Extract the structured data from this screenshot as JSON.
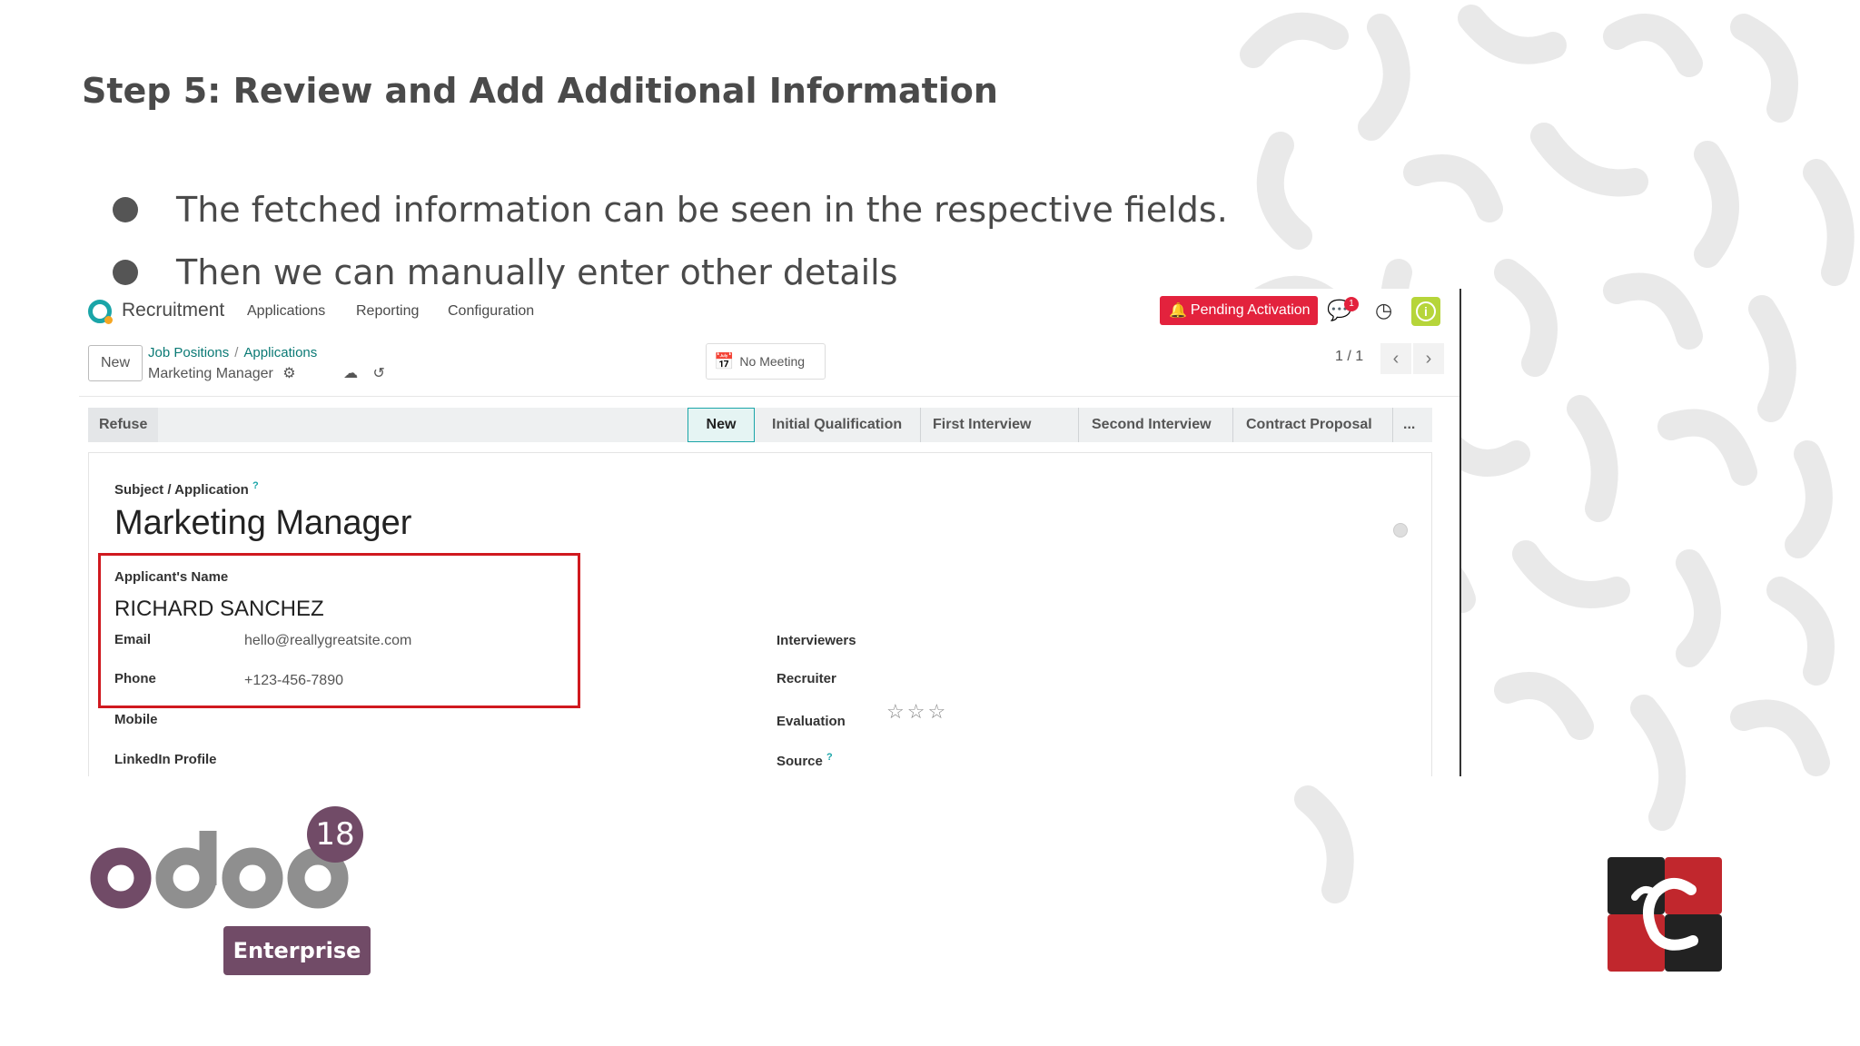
{
  "slide": {
    "title": "Step 5: Review and Add Additional Information",
    "bullets": [
      "The fetched information can be seen in the respective fields.",
      "Then we can manually enter other details"
    ]
  },
  "navbar": {
    "app_name": "Recruitment",
    "menu": [
      "Applications",
      "Reporting",
      "Configuration"
    ],
    "pending_label": "Pending Activation",
    "chat_count": "1",
    "info_glyph": "i"
  },
  "control": {
    "new_label": "New",
    "crumb_parent": "Job Positions",
    "crumb_sep": "/",
    "crumb_current": "Applications",
    "record_name": "Marketing Manager",
    "meeting_label": "No Meeting",
    "pager": "1 / 1"
  },
  "statusbar": {
    "refuse_label": "Refuse",
    "active_stage": "New",
    "stages": [
      "Initial Qualification",
      "First Interview",
      "Second Interview",
      "Contract Proposal",
      "..."
    ]
  },
  "form": {
    "subject_label": "Subject / Application",
    "subject_help": "?",
    "subject_value": "Marketing Manager",
    "applicant_label": "Applicant's Name",
    "applicant_value": "RICHARD SANCHEZ",
    "email_label": "Email",
    "email_value": "hello@reallygreatsite.com",
    "phone_label": "Phone",
    "phone_value": "+123-456-7890",
    "mobile_label": "Mobile",
    "linkedin_label": "LinkedIn Profile",
    "interviewers_label": "Interviewers",
    "recruiter_label": "Recruiter",
    "evaluation_label": "Evaluation",
    "evaluation_stars": "☆☆☆",
    "evaluation_rating": 0,
    "source_label": "Source",
    "source_help": "?"
  },
  "branding": {
    "version": "18",
    "edition": "Enterprise",
    "odoo_purple": "#714b67",
    "odoo_gray": "#8f8f8f",
    "accent_red": "#e3223d",
    "accent_teal": "#1aa5a8"
  }
}
